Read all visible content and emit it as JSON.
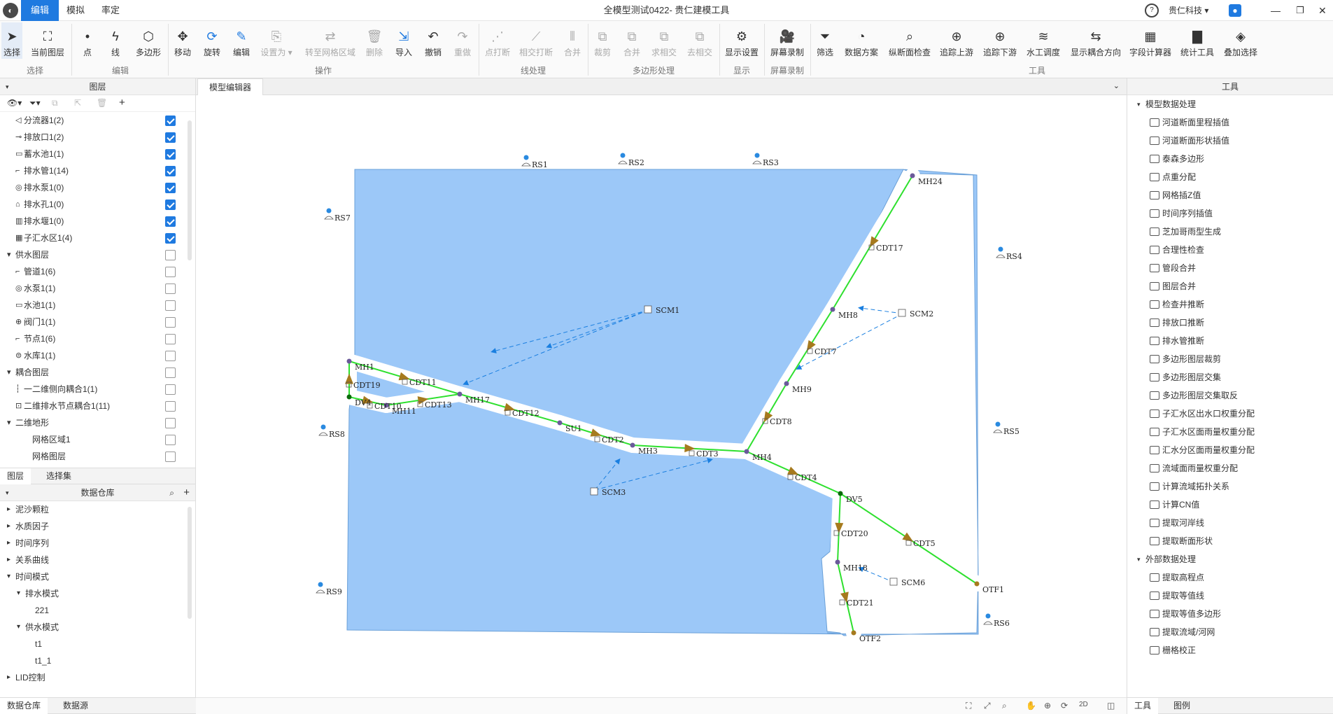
{
  "app": {
    "title": "全模型测试0422- 贵仁建模工具",
    "company": "贵仁科技"
  },
  "menu": {
    "tabs": [
      "编辑",
      "模拟",
      "率定"
    ]
  },
  "toolbar": {
    "groups": [
      "选择",
      "编辑",
      "操作",
      "线处理",
      "多边形处理",
      "显示",
      "屏幕录制",
      "工具"
    ],
    "select": [
      "选择",
      "当前图层"
    ],
    "edit": [
      "点",
      "线",
      "多边形"
    ],
    "ops": [
      "移动",
      "旋转",
      "编辑",
      "设置为",
      "转至网格区域",
      "删除",
      "导入",
      "撤销",
      "重做"
    ],
    "line": [
      "点打断",
      "相交打断",
      "合并"
    ],
    "poly": [
      "裁剪",
      "合并",
      "求相交",
      "去相交"
    ],
    "display": [
      "显示设置"
    ],
    "record": [
      "屏幕录制"
    ],
    "tools": [
      "筛选",
      "数据方案",
      "纵断面检查",
      "追踪上游",
      "追踪下游",
      "水工调度",
      "显示耦合方向",
      "字段计算器",
      "统计工具",
      "叠加选择"
    ]
  },
  "layers": {
    "title": "图层",
    "items": [
      {
        "label": "分流器1(2)",
        "indent": 1,
        "checked": true,
        "icon": "◁"
      },
      {
        "label": "排放口1(2)",
        "indent": 1,
        "checked": true,
        "icon": "⊸"
      },
      {
        "label": "蓄水池1(1)",
        "indent": 1,
        "checked": true,
        "icon": "▭"
      },
      {
        "label": "排水管1(14)",
        "indent": 1,
        "checked": true,
        "icon": "⌐"
      },
      {
        "label": "排水泵1(0)",
        "indent": 1,
        "checked": true,
        "icon": "◎"
      },
      {
        "label": "排水孔1(0)",
        "indent": 1,
        "checked": true,
        "icon": "⌂"
      },
      {
        "label": "排水堰1(0)",
        "indent": 1,
        "checked": true,
        "icon": "▥"
      },
      {
        "label": "子汇水区1(4)",
        "indent": 1,
        "checked": true,
        "icon": "▦"
      },
      {
        "label": "供水图层",
        "indent": 0,
        "checked": false,
        "icon": "▾"
      },
      {
        "label": "管道1(6)",
        "indent": 1,
        "checked": false,
        "icon": "⌐"
      },
      {
        "label": "水泵1(1)",
        "indent": 1,
        "checked": false,
        "icon": "◎"
      },
      {
        "label": "水池1(1)",
        "indent": 1,
        "checked": false,
        "icon": "▭"
      },
      {
        "label": "阀门1(1)",
        "indent": 1,
        "checked": false,
        "icon": "⊕"
      },
      {
        "label": "节点1(6)",
        "indent": 1,
        "checked": false,
        "icon": "⌐"
      },
      {
        "label": "水库1(1)",
        "indent": 1,
        "checked": false,
        "icon": "⊜"
      },
      {
        "label": "耦合图层",
        "indent": 0,
        "checked": false,
        "icon": "▾"
      },
      {
        "label": "一二维侧向耦合1(1)",
        "indent": 1,
        "checked": false,
        "icon": "┆"
      },
      {
        "label": "二维排水节点耦合1(11)",
        "indent": 1,
        "checked": false,
        "icon": "⊡"
      },
      {
        "label": "二维地形",
        "indent": 0,
        "checked": false,
        "icon": "▾"
      },
      {
        "label": "网格区域1",
        "indent": 2,
        "checked": false,
        "icon": ""
      },
      {
        "label": "网格图层",
        "indent": 2,
        "checked": false,
        "icon": ""
      }
    ]
  },
  "lefttabs": [
    "图层",
    "选择集"
  ],
  "warehouse": {
    "title": "数据仓库",
    "items": [
      {
        "label": "泥沙颗粒",
        "indent": 0,
        "arrow": "▸"
      },
      {
        "label": "水质因子",
        "indent": 0,
        "arrow": "▸"
      },
      {
        "label": "时间序列",
        "indent": 0,
        "arrow": "▸"
      },
      {
        "label": "关系曲线",
        "indent": 0,
        "arrow": "▸"
      },
      {
        "label": "时间模式",
        "indent": 0,
        "arrow": "▾"
      },
      {
        "label": "排水模式",
        "indent": 1,
        "arrow": "▾"
      },
      {
        "label": "221",
        "indent": 2,
        "arrow": ""
      },
      {
        "label": "供水模式",
        "indent": 1,
        "arrow": "▾"
      },
      {
        "label": "t1",
        "indent": 2,
        "arrow": ""
      },
      {
        "label": "t1_1",
        "indent": 2,
        "arrow": ""
      },
      {
        "label": "LID控制",
        "indent": 0,
        "arrow": "▸"
      }
    ]
  },
  "bottomtabs": [
    "数据仓库",
    "数据源"
  ],
  "doc": {
    "tab": "模型编辑器"
  },
  "tools": {
    "title": "工具",
    "groups": [
      {
        "name": "模型数据处理",
        "items": [
          "河道断面里程插值",
          "河道断面形状插值",
          "泰森多边形",
          "点重分配",
          "网格插Z值",
          "时间序列插值",
          "芝加哥雨型生成",
          "合理性检查",
          "管段合并",
          "图层合并",
          "检查井推断",
          "排放口推断",
          "排水管推断",
          "多边形图层裁剪",
          "多边形图层交集",
          "多边形图层交集取反",
          "子汇水区出水口权重分配",
          "子汇水区面雨量权重分配",
          "汇水分区面雨量权重分配",
          "流域面雨量权重分配",
          "计算流域拓扑关系",
          "计算CN值",
          "提取河岸线",
          "提取断面形状"
        ]
      },
      {
        "name": "外部数据处理",
        "items": [
          "提取高程点",
          "提取等值线",
          "提取等值多边形",
          "提取流域/河网",
          "栅格校正"
        ]
      }
    ],
    "tabs": [
      "工具",
      "图例"
    ]
  },
  "map": {
    "rain": [
      "RS1",
      "RS2",
      "RS3",
      "RS4",
      "RS5",
      "RS6",
      "RS7",
      "RS8",
      "RS9"
    ],
    "nodes": [
      "MH1",
      "MH24",
      "MH8",
      "MH9",
      "MH17",
      "MH11",
      "MH3",
      "MH4",
      "MH18",
      "DV4",
      "DV5",
      "OTF1",
      "OTF2",
      "SU1"
    ],
    "pipes": [
      "CDT17",
      "CDT7",
      "CDT8",
      "CDT19",
      "CDT10",
      "CDT11",
      "CDT13",
      "CDT12",
      "CDT2",
      "CDT3",
      "CDT4",
      "CDT5",
      "CDT20",
      "CDT21"
    ],
    "sub": [
      "SCM1",
      "SCM2",
      "SCM3",
      "SCM6"
    ],
    "status": [
      "2D"
    ]
  }
}
